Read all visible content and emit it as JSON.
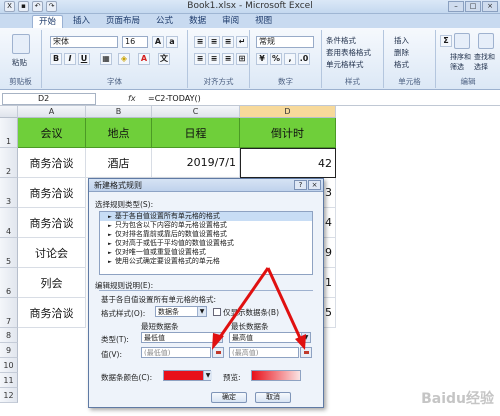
{
  "window": {
    "title": "Book1.xlsx - Microsoft Excel"
  },
  "tabs": [
    "开始",
    "插入",
    "页面布局",
    "公式",
    "数据",
    "审阅",
    "视图"
  ],
  "ribbon": {
    "paste_label": "粘贴",
    "font_name": "宋体",
    "font_size": "16",
    "number_format": "常规",
    "cond_format": "条件格式",
    "table_format": "套用表格格式",
    "cell_style": "单元格样式",
    "insert": "插入",
    "delete": "删除",
    "format": "格式",
    "sort_filter": "排序和\n筛选",
    "find_select": "查找和\n选择",
    "groups": [
      "剪贴板",
      "字体",
      "对齐方式",
      "数字",
      "样式",
      "单元格",
      "编辑"
    ]
  },
  "formula_bar": {
    "name_box": "D2",
    "fx": "fx",
    "formula": "=C2-TODAY()"
  },
  "columns": [
    "A",
    "B",
    "C",
    "D"
  ],
  "rows": [
    "1",
    "2",
    "3",
    "4",
    "5",
    "6",
    "7",
    "8",
    "9",
    "10",
    "11",
    "12"
  ],
  "sheet": {
    "headers": [
      "会议",
      "地点",
      "日程",
      "倒计时"
    ],
    "rows": [
      {
        "a": "商务洽谈",
        "b": "酒店",
        "c": "2019/7/1",
        "d": "42"
      },
      {
        "a": "商务洽谈",
        "b": "",
        "c": "",
        "d": "3"
      },
      {
        "a": "商务洽谈",
        "b": "",
        "c": "",
        "d": "4"
      },
      {
        "a": "讨论会",
        "b": "",
        "c": "",
        "d": "9"
      },
      {
        "a": "列会",
        "b": "",
        "c": "",
        "d": "1"
      },
      {
        "a": "商务洽谈",
        "b": "",
        "c": "",
        "d": "5"
      }
    ]
  },
  "dialog": {
    "title": "新建格式规则",
    "select_rule_type": "选择规则类型(S):",
    "rules": [
      "基于各自值设置所有单元格的格式",
      "只为包含以下内容的单元格设置格式",
      "仅对排名靠前或靠后的数值设置格式",
      "仅对高于或低于平均值的数值设置格式",
      "仅对唯一值或重复值设置格式",
      "使用公式确定要设置格式的单元格"
    ],
    "edit_rule_desc": "编辑规则说明(E):",
    "format_all_by_value": "基于各自值设置所有单元格的格式:",
    "format_style_label": "格式样式(O):",
    "format_style_value": "数据条",
    "show_bar_only": "仅显示数据条(B)",
    "min_label": "最短数据条",
    "max_label": "最长数据条",
    "type_label": "类型(T):",
    "value_label": "值(V):",
    "min_type": "最低值",
    "max_type": "最高值",
    "min_value": "(最低值)",
    "max_value": "(最高值)",
    "bar_color_label": "数据条颜色(C):",
    "preview_label": "预览:",
    "ok": "确定",
    "cancel": "取消",
    "bar_color": "#e8101a"
  },
  "watermark": "Baidu经验"
}
